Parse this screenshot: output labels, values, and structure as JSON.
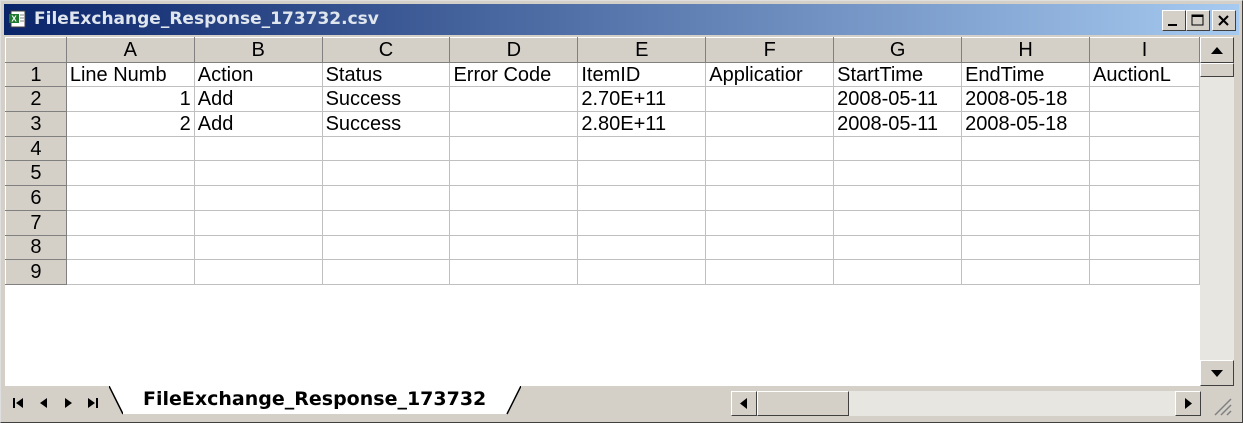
{
  "window": {
    "title": "FileExchange_Response_173732.csv",
    "controls": [
      "minimize-icon",
      "restore-icon",
      "close-icon"
    ]
  },
  "grid": {
    "column_headers": [
      "A",
      "B",
      "C",
      "D",
      "E",
      "F",
      "G",
      "H",
      "I"
    ],
    "row_headers": [
      "1",
      "2",
      "3",
      "4",
      "5",
      "6",
      "7",
      "8",
      "9"
    ],
    "rows": [
      [
        "Line Numb",
        "Action",
        "Status",
        "Error Code",
        "ItemID",
        "Applicatior",
        "StartTime",
        "EndTime",
        "AuctionL"
      ],
      [
        "1",
        "Add",
        "Success",
        "",
        "2.70E+11",
        "",
        "2008-05-11",
        "2008-05-18",
        ""
      ],
      [
        "2",
        "Add",
        "Success",
        "",
        "2.80E+11",
        "",
        "2008-05-11",
        "2008-05-18",
        ""
      ],
      [
        "",
        "",
        "",
        "",
        "",
        "",
        "",
        "",
        ""
      ],
      [
        "",
        "",
        "",
        "",
        "",
        "",
        "",
        "",
        ""
      ],
      [
        "",
        "",
        "",
        "",
        "",
        "",
        "",
        "",
        ""
      ],
      [
        "",
        "",
        "",
        "",
        "",
        "",
        "",
        "",
        ""
      ],
      [
        "",
        "",
        "",
        "",
        "",
        "",
        "",
        "",
        ""
      ],
      [
        "",
        "",
        "",
        "",
        "",
        "",
        "",
        "",
        ""
      ]
    ],
    "numeric_cells": [
      [
        1,
        0
      ],
      [
        2,
        0
      ]
    ]
  },
  "sheet_tabs": {
    "active": "FileExchange_Response_173732",
    "nav_icons": [
      "first-sheet-icon",
      "prev-sheet-icon",
      "next-sheet-icon",
      "last-sheet-icon"
    ]
  },
  "colors": {
    "title_gradient_start": "#0a246a",
    "title_gradient_end": "#a6caf0",
    "chrome": "#d4d0c8",
    "grid_lines": "#c0c0c0"
  }
}
